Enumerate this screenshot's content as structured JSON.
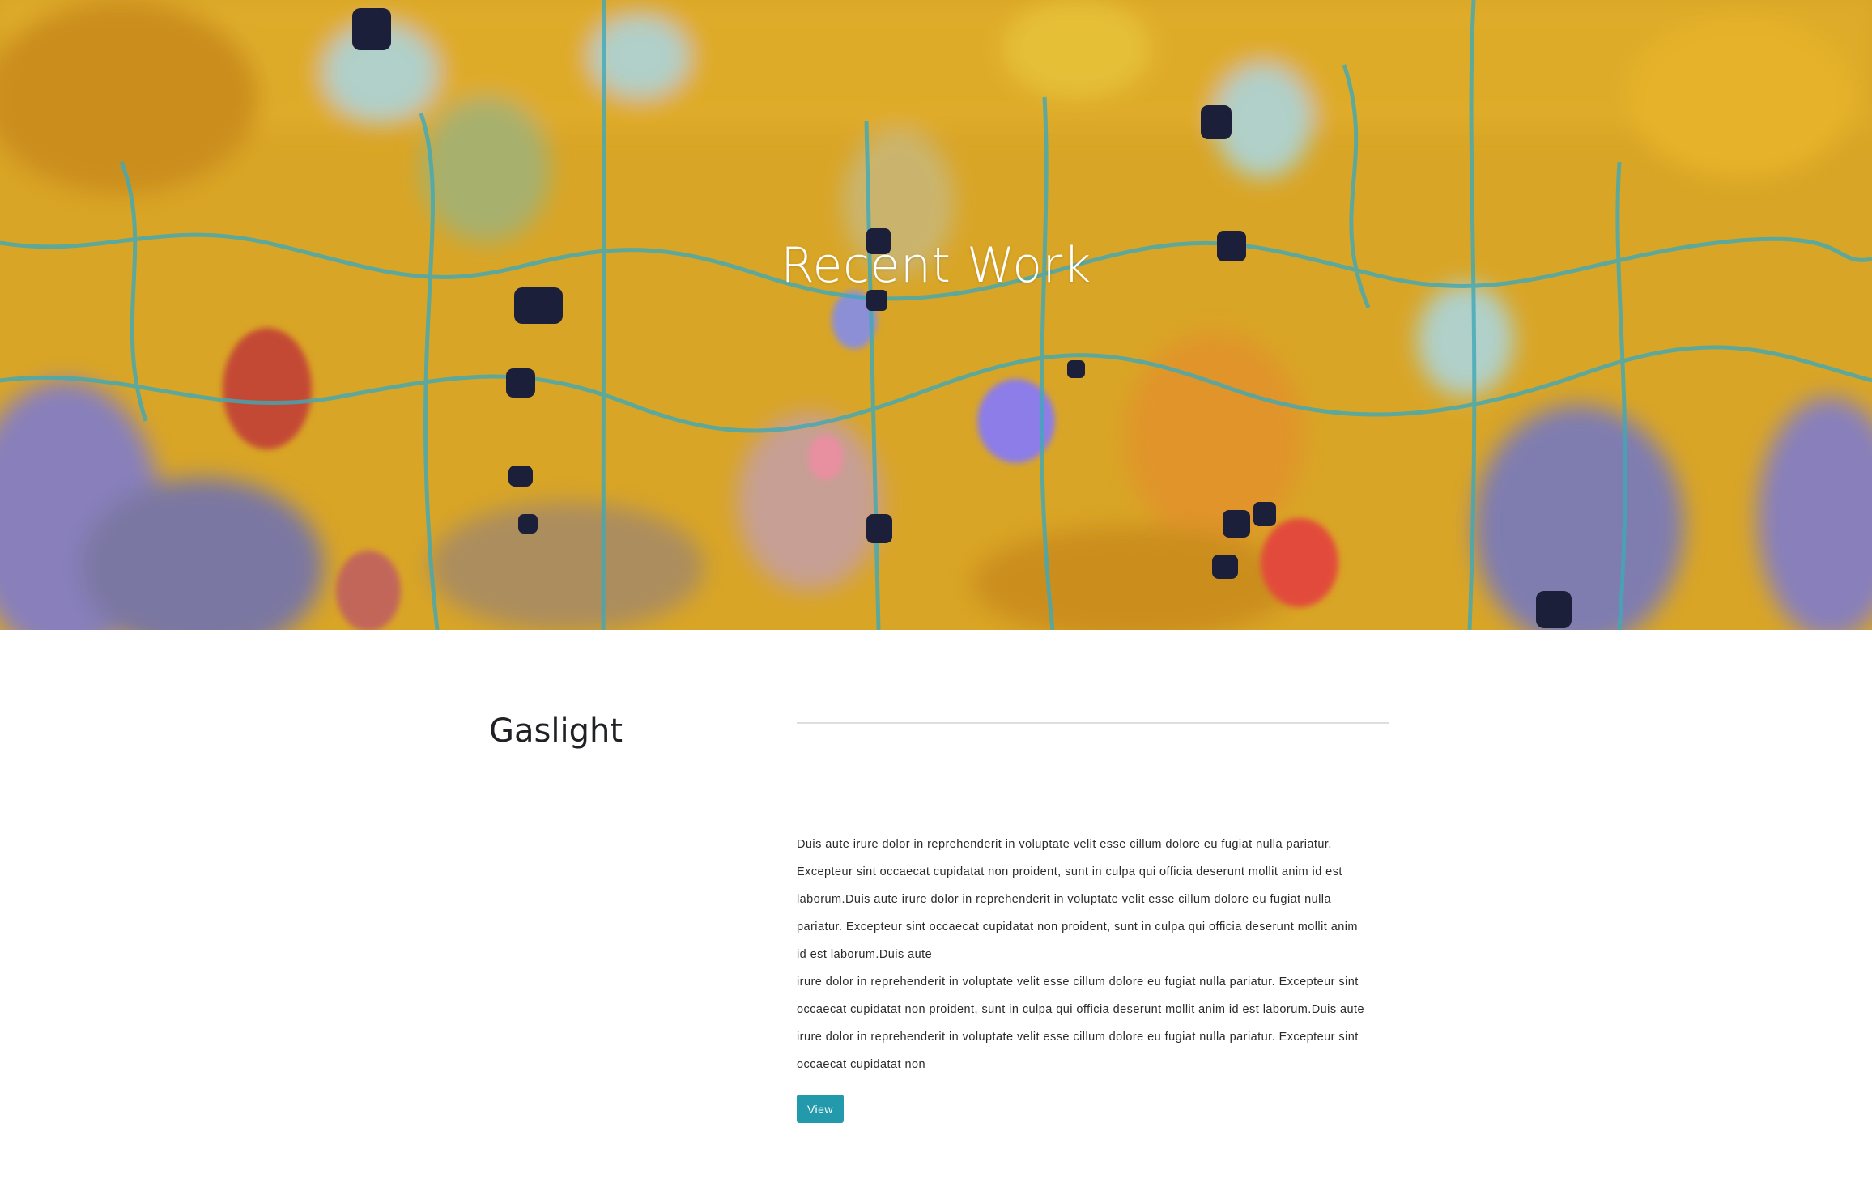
{
  "hero": {
    "title": "Recent Work",
    "palette": {
      "base": "#d9a526",
      "gold": "#e8b52a",
      "ochre": "#c98a1e",
      "turquoise": "#3fa9b8",
      "lavender": "#7a79d6",
      "red": "#d0453a",
      "navy": "#1c1f3a",
      "sky": "#a9d8e6"
    }
  },
  "work": {
    "title": "Gaslight",
    "description_lines": [
      "Duis aute irure dolor in reprehenderit in voluptate velit esse cillum dolore eu fugiat nulla pariatur.",
      "Excepteur sint occaecat cupidatat non proident, sunt in culpa qui officia deserunt mollit anim id est",
      "laborum.Duis aute irure dolor in reprehenderit in voluptate velit esse cillum dolore eu fugiat nulla",
      "pariatur. Excepteur sint occaecat cupidatat non proident, sunt in culpa qui officia deserunt mollit anim",
      "id est laborum.Duis aute",
      "irure dolor in reprehenderit in voluptate velit esse cillum dolore eu fugiat nulla pariatur. Excepteur sint",
      "occaecat cupidatat non proident, sunt in culpa qui officia deserunt mollit anim id est laborum.Duis aute",
      "irure dolor in reprehenderit in voluptate velit esse cillum dolore eu fugiat nulla pariatur. Excepteur sint",
      "occaecat cupidatat non"
    ],
    "view_label": "View",
    "button_color": "#2399ac"
  }
}
